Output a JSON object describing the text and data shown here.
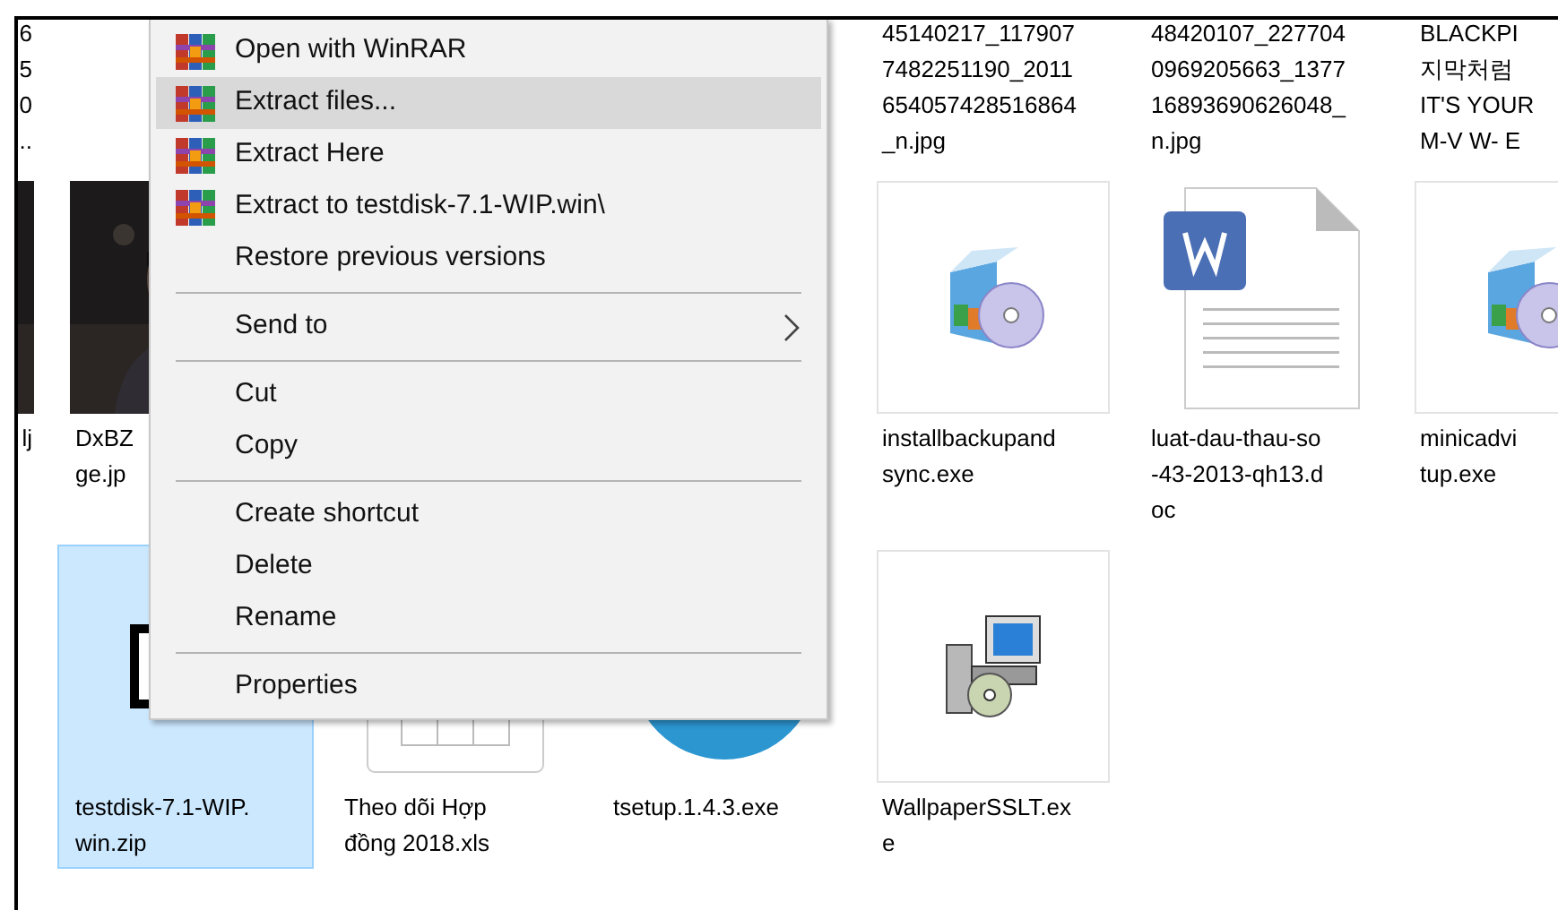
{
  "file_rows": [
    {
      "edge_item": {
        "kind": "label",
        "lines": [
          "6",
          "5",
          "0",
          ".."
        ],
        "selected": false
      },
      "right": [
        {
          "kind": "label",
          "lines": [
            "45140217_117907",
            "7482251190_2011",
            "654057428516864",
            "_n.jpg"
          ],
          "selected": false
        },
        {
          "kind": "label",
          "lines": [
            "48420107_227704",
            "0969205663_1377",
            "16893690626048_",
            "n.jpg"
          ],
          "selected": false
        },
        {
          "kind": "label",
          "lines": [
            "BLACKPI",
            "지막처럼",
            "IT'S YOUR",
            "M-V W- E"
          ],
          "selected": false
        }
      ]
    },
    {
      "edge_item": {
        "lines": [
          "lj"
        ],
        "selected": false
      },
      "left": [
        {
          "lines": [
            "DxBZ",
            "ge.jp"
          ],
          "selected": false
        }
      ],
      "right": [
        {
          "kind": "installer",
          "lines": [
            "installbackupand",
            "sync.exe"
          ],
          "selected": false
        },
        {
          "kind": "document",
          "lines": [
            "luat-dau-thau-so",
            "-43-2013-qh13.d",
            "oc"
          ],
          "selected": false
        },
        {
          "kind": "installer",
          "lines": [
            "minicadvi",
            "tup.exe"
          ],
          "selected": false
        }
      ]
    },
    {
      "left": [
        {
          "kind": "archive",
          "lines": [
            "testdisk-7.1-WIP.",
            "win.zip"
          ],
          "selected": true
        },
        {
          "kind": "spreadsheet",
          "lines": [
            "Theo dõi Hợp",
            "đồng 2018.xls"
          ],
          "selected": false
        },
        {
          "kind": "round",
          "lines": [
            "tsetup.1.4.3.exe"
          ],
          "selected": false
        },
        {
          "kind": "setup",
          "lines": [
            "WallpaperSSLT.ex",
            "e"
          ],
          "selected": false
        }
      ]
    }
  ],
  "context_menu": {
    "items": [
      {
        "kind": "item",
        "label": "Open with WinRAR",
        "has_icon": true,
        "submenu": false,
        "selected": false
      },
      {
        "kind": "item",
        "label": "Extract files...",
        "has_icon": true,
        "submenu": false,
        "selected": true
      },
      {
        "kind": "item",
        "label": "Extract Here",
        "has_icon": true,
        "submenu": false,
        "selected": false
      },
      {
        "kind": "item",
        "label": "Extract to testdisk-7.1-WIP.win\\",
        "has_icon": true,
        "submenu": false,
        "selected": false
      },
      {
        "kind": "item",
        "label": "Restore previous versions",
        "has_icon": false,
        "submenu": false,
        "selected": false
      },
      {
        "kind": "separator"
      },
      {
        "kind": "item",
        "label": "Send to",
        "has_icon": false,
        "submenu": true,
        "selected": false
      },
      {
        "kind": "separator"
      },
      {
        "kind": "item",
        "label": "Cut",
        "has_icon": false,
        "submenu": false,
        "selected": false
      },
      {
        "kind": "item",
        "label": "Copy",
        "has_icon": false,
        "submenu": false,
        "selected": false
      },
      {
        "kind": "separator"
      },
      {
        "kind": "item",
        "label": "Create shortcut",
        "has_icon": false,
        "submenu": false,
        "selected": false
      },
      {
        "kind": "item",
        "label": "Delete",
        "has_icon": false,
        "submenu": false,
        "selected": false
      },
      {
        "kind": "item",
        "label": "Rename",
        "has_icon": false,
        "submenu": false,
        "selected": false
      },
      {
        "kind": "separator"
      },
      {
        "kind": "item",
        "label": "Properties",
        "has_icon": false,
        "submenu": false,
        "selected": false
      }
    ]
  }
}
